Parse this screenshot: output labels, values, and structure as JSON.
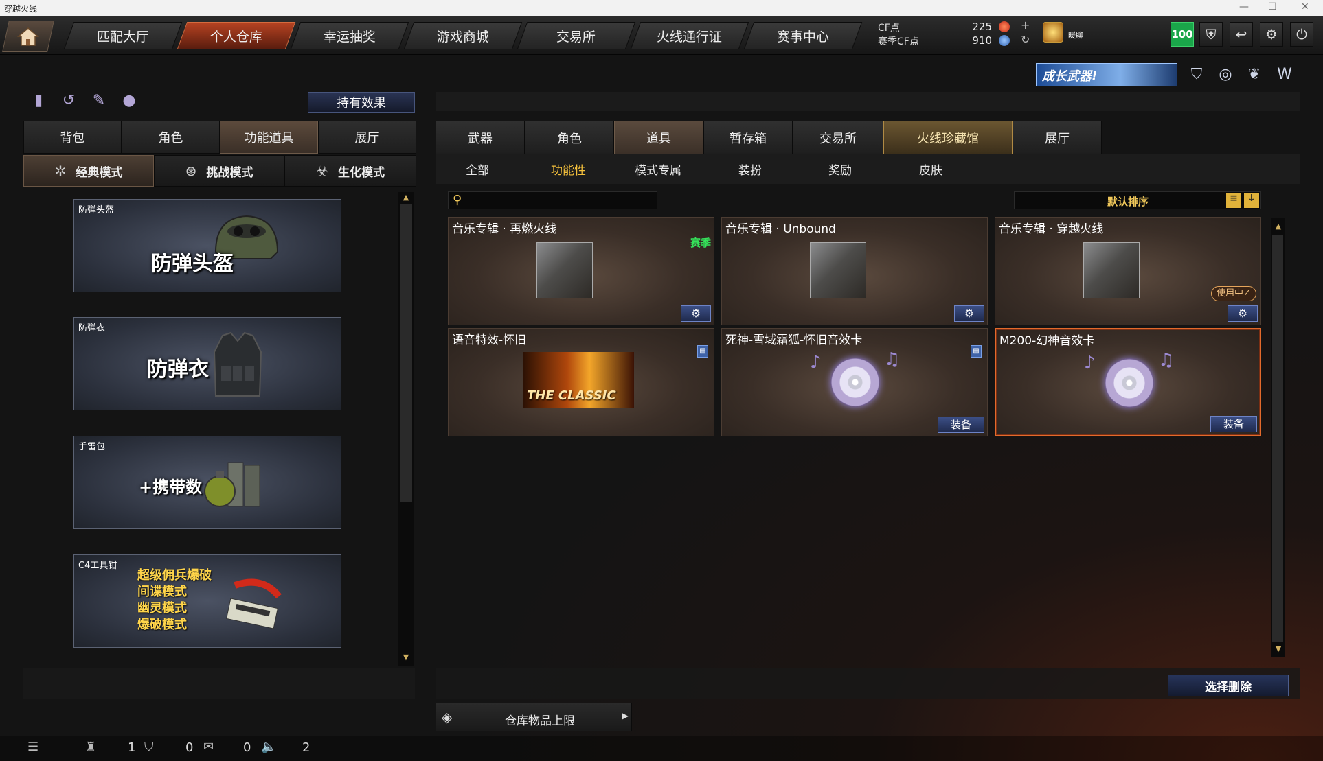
{
  "window": {
    "title": "穿越火线"
  },
  "topnav": {
    "tabs": [
      "匹配大厅",
      "个人仓库",
      "幸运抽奖",
      "游戏商城",
      "交易所",
      "火线通行证",
      "赛事中心"
    ],
    "active_index": 1,
    "cf_label": "CF点",
    "cf_value": "225",
    "season_cf_label": "赛季CF点",
    "season_cf_value": "910",
    "player_name": "暖聊",
    "level": "100"
  },
  "banner": {
    "text": "成长武器!"
  },
  "left_panel": {
    "effects_button": "持有效果",
    "tabs": [
      "背包",
      "角色",
      "功能道具",
      "展厅"
    ],
    "active_tab": 2,
    "modes": [
      "经典模式",
      "挑战模式",
      "生化模式"
    ],
    "active_mode": 0,
    "cards": [
      {
        "caption": "防弹头盔",
        "big_text": "防弹头盔"
      },
      {
        "caption": "防弹衣",
        "big_text": "防弹衣"
      },
      {
        "caption": "手雷包",
        "big_text": "+携带数"
      },
      {
        "caption": "C4工具钳",
        "lines": [
          "超级佣兵爆破",
          "间谍模式",
          "幽灵模式",
          "爆破模式"
        ]
      }
    ]
  },
  "right_panel": {
    "tabs": [
      "武器",
      "角色",
      "道具",
      "暂存箱",
      "交易所",
      "火线珍藏馆",
      "展厅"
    ],
    "active_tab": 2,
    "highlight_tab": 5,
    "subtabs": [
      "全部",
      "功能性",
      "模式专属",
      "装扮",
      "奖励",
      "皮肤"
    ],
    "active_subtab": 1,
    "search": {
      "value": "",
      "placeholder": ""
    },
    "sort_label": "默认排序",
    "items": [
      {
        "name": "音乐专辑 · 再燃火线",
        "badge": "赛季",
        "status": ""
      },
      {
        "name": "音乐专辑 · Unbound",
        "badge": "",
        "status": ""
      },
      {
        "name": "音乐专辑 · 穿越火线",
        "badge": "",
        "status": "使用中✓"
      },
      {
        "name": "语音特效-怀旧",
        "art_text": "THE CLASSIC",
        "status": ""
      },
      {
        "name": "死神-雪域霜狐-怀旧音效卡",
        "button": "装备"
      },
      {
        "name": "M200-幻神音效卡",
        "button": "装备"
      }
    ],
    "delete_button": "选择删除",
    "capacity_label": "仓库物品上限"
  },
  "statusbar": {
    "values": [
      "1",
      "0",
      "0",
      "2"
    ]
  },
  "colors": {
    "accent_orange": "#b64322",
    "level_green": "#1aa64a",
    "season_green": "#35e35b",
    "gold_text": "#f5c13c"
  }
}
